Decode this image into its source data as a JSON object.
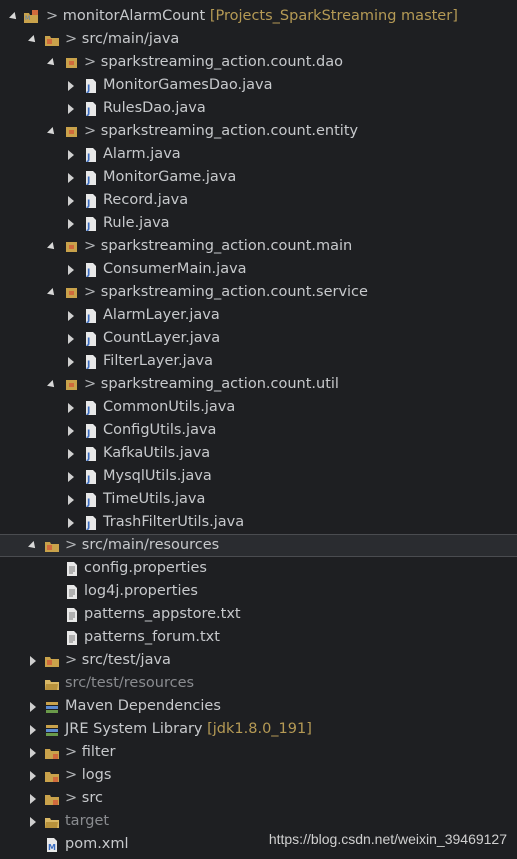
{
  "rows": [
    {
      "name": "project-node",
      "text": "monitorAlarmCount",
      "prefix": "> ",
      "decor": " [Projects_SparkStreaming master]",
      "icon": "project-icon"
    },
    {
      "name": "src-main-java",
      "text": "src/main/java",
      "prefix": "> ",
      "icon": "source-folder-icon"
    },
    {
      "name": "package-dao",
      "text": "sparkstreaming_action.count.dao",
      "prefix": "> ",
      "icon": "package-icon"
    },
    {
      "name": "file-monitorgamesdao",
      "text": "MonitorGamesDao.java",
      "icon": "java-file-icon"
    },
    {
      "name": "file-rulesdao",
      "text": "RulesDao.java",
      "icon": "java-file-icon"
    },
    {
      "name": "package-entity",
      "text": "sparkstreaming_action.count.entity",
      "prefix": "> ",
      "icon": "package-icon"
    },
    {
      "name": "file-alarm",
      "text": "Alarm.java",
      "icon": "java-file-icon"
    },
    {
      "name": "file-monitorgame",
      "text": "MonitorGame.java",
      "icon": "java-file-icon"
    },
    {
      "name": "file-record",
      "text": "Record.java",
      "icon": "java-file-icon"
    },
    {
      "name": "file-rule",
      "text": "Rule.java",
      "icon": "java-file-icon"
    },
    {
      "name": "package-main",
      "text": "sparkstreaming_action.count.main",
      "prefix": "> ",
      "icon": "package-icon"
    },
    {
      "name": "file-consumermain",
      "text": "ConsumerMain.java",
      "icon": "java-file-icon"
    },
    {
      "name": "package-service",
      "text": "sparkstreaming_action.count.service",
      "prefix": "> ",
      "icon": "package-icon"
    },
    {
      "name": "file-alarmlayer",
      "text": "AlarmLayer.java",
      "icon": "java-file-icon"
    },
    {
      "name": "file-countlayer",
      "text": "CountLayer.java",
      "icon": "java-file-icon"
    },
    {
      "name": "file-filterlayer",
      "text": "FilterLayer.java",
      "icon": "java-file-icon"
    },
    {
      "name": "package-util",
      "text": "sparkstreaming_action.count.util",
      "prefix": "> ",
      "icon": "package-icon"
    },
    {
      "name": "file-commonutils",
      "text": "CommonUtils.java",
      "icon": "java-file-icon"
    },
    {
      "name": "file-configutils",
      "text": "ConfigUtils.java",
      "icon": "java-file-icon"
    },
    {
      "name": "file-kafkautils",
      "text": "KafkaUtils.java",
      "icon": "java-file-icon"
    },
    {
      "name": "file-mysqlutils",
      "text": "MysqlUtils.java",
      "icon": "java-file-icon"
    },
    {
      "name": "file-timeutils",
      "text": "TimeUtils.java",
      "icon": "java-file-icon"
    },
    {
      "name": "file-trashfilterutils",
      "text": "TrashFilterUtils.java",
      "icon": "java-file-icon"
    },
    {
      "name": "src-main-resources",
      "text": "src/main/resources",
      "prefix": "> ",
      "icon": "source-folder-icon"
    },
    {
      "name": "file-config-properties",
      "text": "config.properties",
      "icon": "text-file-icon"
    },
    {
      "name": "file-log4j-properties",
      "text": "log4j.properties",
      "icon": "text-file-icon"
    },
    {
      "name": "file-patterns-appstore",
      "text": "patterns_appstore.txt",
      "icon": "text-file-icon"
    },
    {
      "name": "file-patterns-forum",
      "text": "patterns_forum.txt",
      "icon": "text-file-icon"
    },
    {
      "name": "src-test-java",
      "text": "src/test/java",
      "prefix": "> ",
      "icon": "source-folder-icon"
    },
    {
      "name": "src-test-resources",
      "text": "src/test/resources",
      "icon": "empty-source-folder-icon"
    },
    {
      "name": "maven-dependencies",
      "text": "Maven Dependencies",
      "icon": "library-icon"
    },
    {
      "name": "jre-system-library",
      "text": "JRE System Library",
      "decor": " [jdk1.8.0_191]",
      "icon": "library-icon"
    },
    {
      "name": "folder-filter",
      "text": "filter",
      "prefix": "> ",
      "icon": "folder-icon"
    },
    {
      "name": "folder-logs",
      "text": "logs",
      "prefix": "> ",
      "icon": "folder-icon"
    },
    {
      "name": "folder-src",
      "text": "src",
      "prefix": "> ",
      "icon": "folder-icon"
    },
    {
      "name": "folder-target",
      "text": "target",
      "icon": "plain-folder-icon"
    },
    {
      "name": "file-pom-xml",
      "text": "pom.xml",
      "icon": "xml-file-icon"
    }
  ],
  "watermark": "https://blog.csdn.net/weixin_39469127",
  "colors": {
    "background": "#1e1f22",
    "text": "#c7c9cc",
    "decoration": "#b59a55",
    "selection": "#2a2c30"
  }
}
